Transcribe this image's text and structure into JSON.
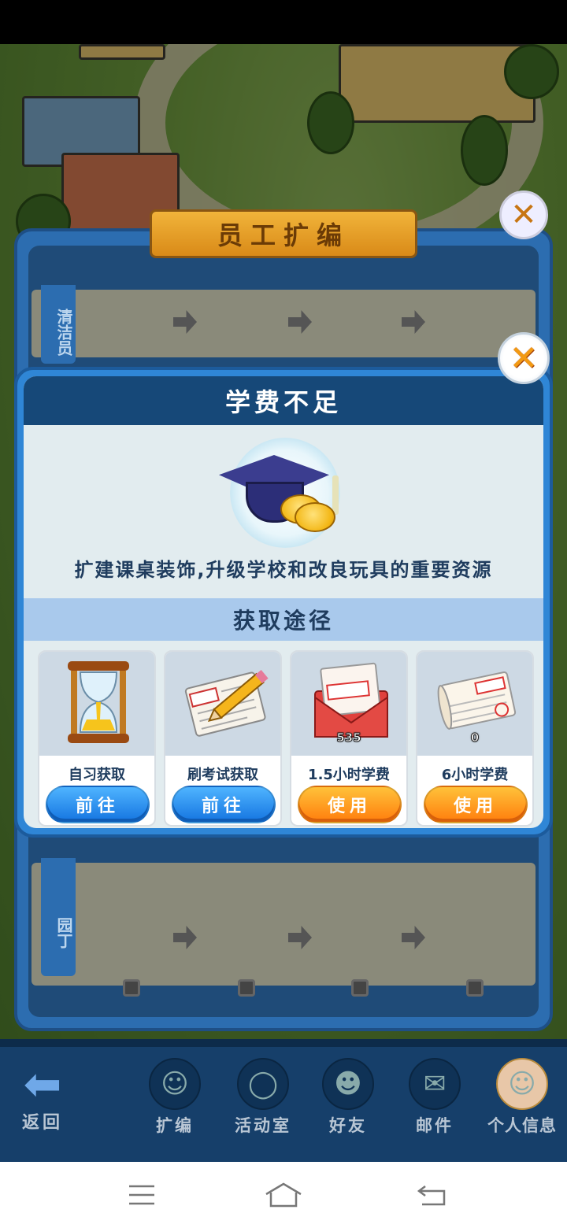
{
  "staff_panel": {
    "title": "员工扩编",
    "row1_tag": "清洁员",
    "row2_tag": "园丁"
  },
  "dialog": {
    "title": "学费不足",
    "item_icon": "graduation-cap-with-coins-icon",
    "description": "扩建课桌装饰,升级学校和改良玩具的重要资源",
    "section_title": "获取途径",
    "sources": [
      {
        "icon": "hourglass-icon",
        "name": "自习获取",
        "button": "前往",
        "count": ""
      },
      {
        "icon": "exam-paper-pencil-icon",
        "name": "刷考试获取",
        "button": "前往",
        "count": ""
      },
      {
        "icon": "funding-envelope-icon",
        "name": "1.5小时学费",
        "button": "使用",
        "count": "535"
      },
      {
        "icon": "receipt-scroll-icon",
        "name": "6小时学费",
        "button": "使用",
        "count": "0"
      }
    ],
    "close_icon": "close-icon"
  },
  "bottom_nav": {
    "back": "返回",
    "items": [
      "扩编",
      "活动室",
      "好友",
      "邮件",
      "个人信息"
    ]
  },
  "colors": {
    "button_blue": "#1474e0",
    "button_orange": "#ff7d0c",
    "title_bar": "#164878",
    "section_bar": "#a9c9ec"
  }
}
